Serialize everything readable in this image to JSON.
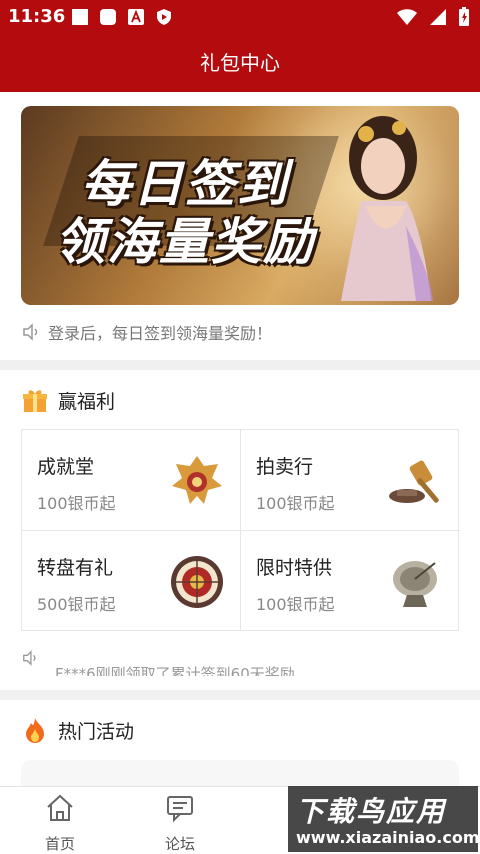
{
  "status_bar": {
    "time": "11:36",
    "icons": [
      "square-icon",
      "square-rounded-icon",
      "a-icon",
      "shield-play-icon"
    ],
    "right_icons": [
      "wifi-icon",
      "signal-icon",
      "battery-charging-icon"
    ]
  },
  "header": {
    "title": "礼包中心"
  },
  "banner": {
    "line1": "每日签到",
    "line2": "领海量奖励"
  },
  "notice": {
    "text": "登录后，每日签到领海量奖励！"
  },
  "welfare": {
    "title": "赢福利",
    "items": [
      {
        "name": "成就堂",
        "price": "100银币起",
        "icon": "trophy-badge-icon"
      },
      {
        "name": "拍卖行",
        "price": "100银币起",
        "icon": "auction-hammer-icon"
      },
      {
        "name": "转盘有礼",
        "price": "500银币起",
        "icon": "roulette-wheel-icon"
      },
      {
        "name": "限时特供",
        "price": "100银币起",
        "icon": "gift-item-icon"
      }
    ]
  },
  "ticker": {
    "text": "F***6刚刚领取了累计签到60天奖励"
  },
  "hot": {
    "title": "热门活动"
  },
  "bottom_nav": {
    "items": [
      {
        "label": "首页",
        "icon": "home-icon"
      },
      {
        "label": "论坛",
        "icon": "forum-icon"
      }
    ]
  },
  "watermark": {
    "line1": "下载鸟应用",
    "line2": "www.xiazainiao.com"
  },
  "colors": {
    "header_bg": "#b30b0e",
    "divider": "#f0f0f0"
  }
}
